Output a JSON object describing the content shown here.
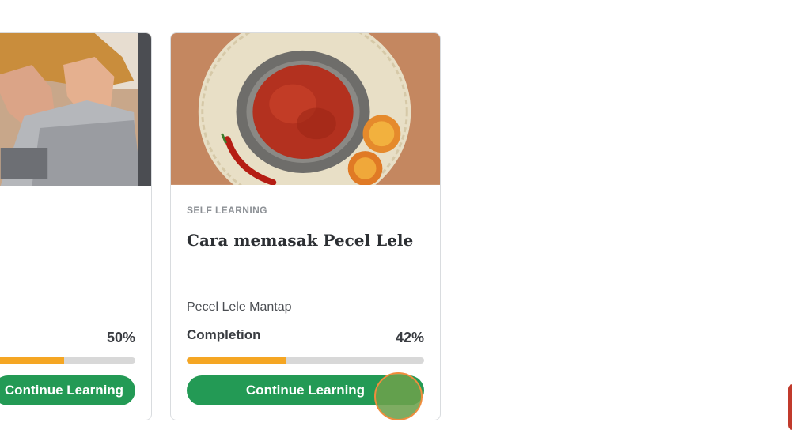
{
  "cards": [
    {
      "id": "card-left",
      "image": "laptop-photo",
      "category": "",
      "title": "",
      "subtitle": "",
      "completion_label": "",
      "completion_value": "50%",
      "progress": 0.5,
      "cta_label": "Continue Learning"
    },
    {
      "id": "card-right",
      "image": "sambal-mortar-photo",
      "category": "SELF LEARNING",
      "title": "Cara memasak Pecel Lele",
      "subtitle": "Pecel Lele Mantap",
      "completion_label": "Completion",
      "completion_value": "42%",
      "progress": 0.42,
      "cta_label": "Continue Learning"
    }
  ],
  "colors": {
    "accent_green": "#239a55",
    "progress_orange": "#f5a623",
    "track_gray": "#d8d8d8",
    "click_ring": "#f08c3c",
    "edge_tab": "#c13a2c"
  }
}
